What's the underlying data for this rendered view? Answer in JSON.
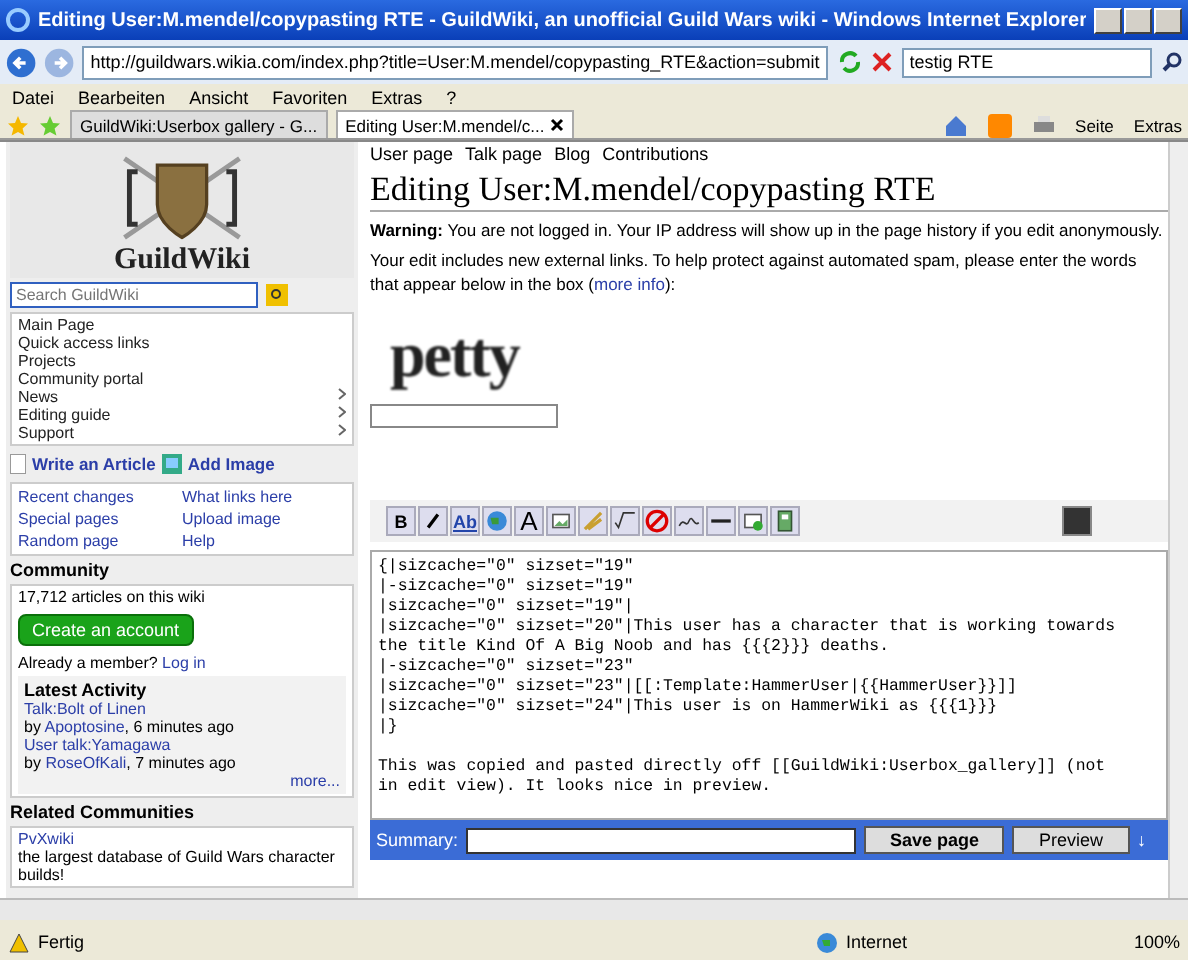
{
  "window": {
    "title": "Editing User:M.mendel/copypasting RTE - GuildWiki, an unofficial Guild Wars wiki - Windows Internet Explorer"
  },
  "address": {
    "url": "http://guildwars.wikia.com/index.php?title=User:M.mendel/copypasting_RTE&action=submit"
  },
  "search": {
    "value": "testig RTE"
  },
  "menu": [
    "Datei",
    "Bearbeiten",
    "Ansicht",
    "Favoriten",
    "Extras",
    "?"
  ],
  "tabs": [
    {
      "label": "GuildWiki:Userbox gallery - G...",
      "selected": false
    },
    {
      "label": "Editing User:M.mendel/c...",
      "selected": true
    }
  ],
  "command_bar": [
    "Seite",
    "Extras"
  ],
  "sidebar": {
    "logo": "GuildWiki",
    "search_placeholder": "Search GuildWiki",
    "nav": [
      {
        "label": "Main Page",
        "submenu": false
      },
      {
        "label": "Quick access links",
        "submenu": false
      },
      {
        "label": "Projects",
        "submenu": false
      },
      {
        "label": "Community portal",
        "submenu": false
      },
      {
        "label": "News",
        "submenu": true
      },
      {
        "label": "Editing guide",
        "submenu": true
      },
      {
        "label": "Support",
        "submenu": true
      }
    ],
    "actions": [
      "Write an Article",
      "Add Image"
    ],
    "links": [
      "Recent changes",
      "What links here",
      "Special pages",
      "Upload image",
      "Random page",
      "Help"
    ],
    "community": {
      "title": "Community",
      "count": "17,712 articles on this wiki",
      "button": "Create an account",
      "member": "Already a member?",
      "login": "Log in"
    },
    "activity": {
      "title": "Latest Activity",
      "items": [
        {
          "page": "Talk:Bolt of Linen",
          "by": "by",
          "user": "Apoptosine",
          "when": ", 6 minutes ago"
        },
        {
          "page": "User talk:Yamagawa",
          "by": "by",
          "user": "RoseOfKali",
          "when": ", 7 minutes ago"
        }
      ],
      "more": "more..."
    },
    "related": {
      "title": "Related Communities",
      "name": "PvXwiki",
      "desc": "the largest database of Guild Wars character builds!"
    }
  },
  "page": {
    "user_tabs": [
      "User page",
      "Talk page",
      "Blog",
      "Contributions"
    ],
    "heading": "Editing User:M.mendel/copypasting RTE",
    "warning_label": "Warning:",
    "warning": "You are not logged in. Your IP address will show up in the page history if you edit anonymously.",
    "spam": "Your edit includes new external links. To help protect against automated spam, please enter the words that appear below in the box (",
    "more_info": "more info",
    "spam_end": "):",
    "captcha": "petty",
    "toolbar": [
      {
        "kind": "bold",
        "label": "B"
      },
      {
        "kind": "italic"
      },
      {
        "kind": "link",
        "label": "Ab"
      },
      {
        "kind": "globe"
      },
      {
        "kind": "heading",
        "label": "A"
      },
      {
        "kind": "image"
      },
      {
        "kind": "media"
      },
      {
        "kind": "math"
      },
      {
        "kind": "nowiki"
      },
      {
        "kind": "sig"
      },
      {
        "kind": "line"
      },
      {
        "kind": "insert"
      },
      {
        "kind": "gallery"
      }
    ],
    "text": "{|sizcache=\"0\" sizset=\"19\"\n|-sizcache=\"0\" sizset=\"19\"\n|sizcache=\"0\" sizset=\"19\"|\n|sizcache=\"0\" sizset=\"20\"|This user has a character that is working towards the title Kind Of A Big Noob and has {{{2}}} deaths.\n|-sizcache=\"0\" sizset=\"23\"\n|sizcache=\"0\" sizset=\"23\"|[[:Template:HammerUser|{{HammerUser}}]]\n|sizcache=\"0\" sizset=\"24\"|This user is on HammerWiki as {{{1}}}\n|}\n\nThis was copied and pasted directly off [[GuildWiki:Userbox_gallery]] (not in edit view). It looks nice in preview.",
    "summary_label": "Summary:",
    "save": "Save page",
    "preview": "Preview",
    "down": "↓"
  },
  "status_bar": {
    "text": "Fertig",
    "zone": "Internet",
    "zoom": "100%"
  }
}
